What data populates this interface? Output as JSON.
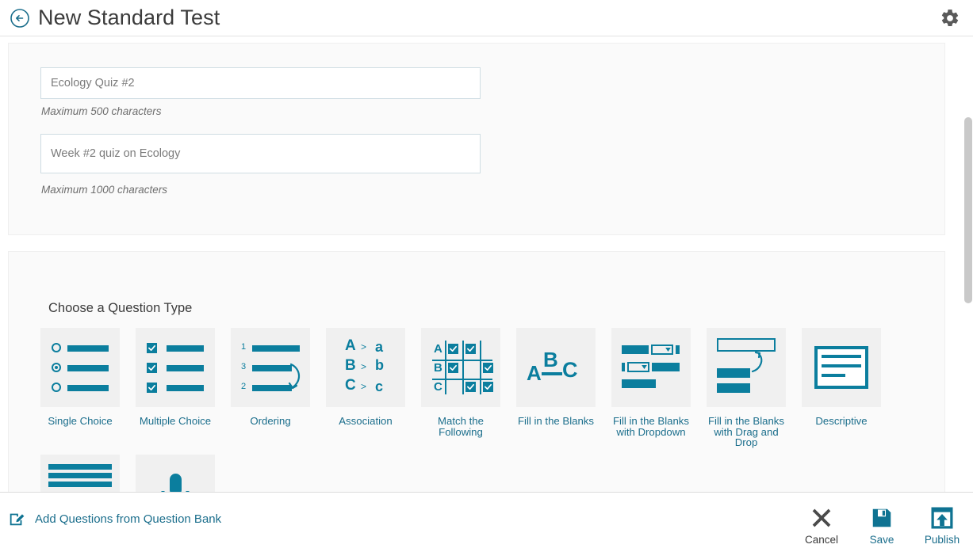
{
  "header": {
    "title": "New Standard Test",
    "back_icon": "arrow-left-circle-icon",
    "settings_icon": "gear-icon"
  },
  "form": {
    "title_value": "Ecology Quiz #2",
    "title_helper": "Maximum 500 characters",
    "description_value": "Week #2 quiz on Ecology",
    "description_helper": "Maximum 1000 characters"
  },
  "question_types": {
    "heading": "Choose a Question Type",
    "items": [
      {
        "label": "Single Choice",
        "icon": "radio-list-icon"
      },
      {
        "label": "Multiple Choice",
        "icon": "checkbox-list-icon"
      },
      {
        "label": "Ordering",
        "icon": "ordered-list-arrow-icon"
      },
      {
        "label": "Association",
        "icon": "letter-pairs-icon"
      },
      {
        "label": "Match the\nFollowing",
        "icon": "match-grid-icon"
      },
      {
        "label": "Fill in the Blanks",
        "icon": "abc-underline-icon"
      },
      {
        "label": "Fill in the Blanks\nwith Dropdown",
        "icon": "dropdown-blanks-icon"
      },
      {
        "label": "Fill in the Blanks\nwith Drag and Drop",
        "icon": "drag-drop-blanks-icon"
      },
      {
        "label": "Descriptive",
        "icon": "paragraph-box-icon"
      },
      {
        "label": "",
        "icon": "passage-radio-icon"
      },
      {
        "label": "",
        "icon": "microphone-icon"
      }
    ],
    "association_rows": [
      {
        "left": "A",
        "op": ">",
        "right": "a"
      },
      {
        "left": "B",
        "op": ">",
        "right": "b"
      },
      {
        "left": "C",
        "op": ">",
        "right": "c"
      }
    ],
    "ordering_numbers": [
      "1",
      "3",
      "2"
    ],
    "match_rows": [
      "A",
      "B",
      "C"
    ],
    "abc_letters": [
      "A",
      "B",
      "C"
    ]
  },
  "footer": {
    "add_from_bank_label": "Add Questions from Question Bank",
    "add_from_bank_icon": "edit-square-icon",
    "actions": [
      {
        "label": "Cancel",
        "icon": "close-x-icon"
      },
      {
        "label": "Save",
        "icon": "floppy-disk-icon"
      },
      {
        "label": "Publish",
        "icon": "publish-upload-icon"
      }
    ]
  },
  "colors": {
    "teal": "#0b7e9e",
    "link_teal": "#1b6e8c",
    "panel_bg": "#fafafa",
    "thumb_bg": "#f0f0f0",
    "text_dark": "#3b3b3b"
  }
}
